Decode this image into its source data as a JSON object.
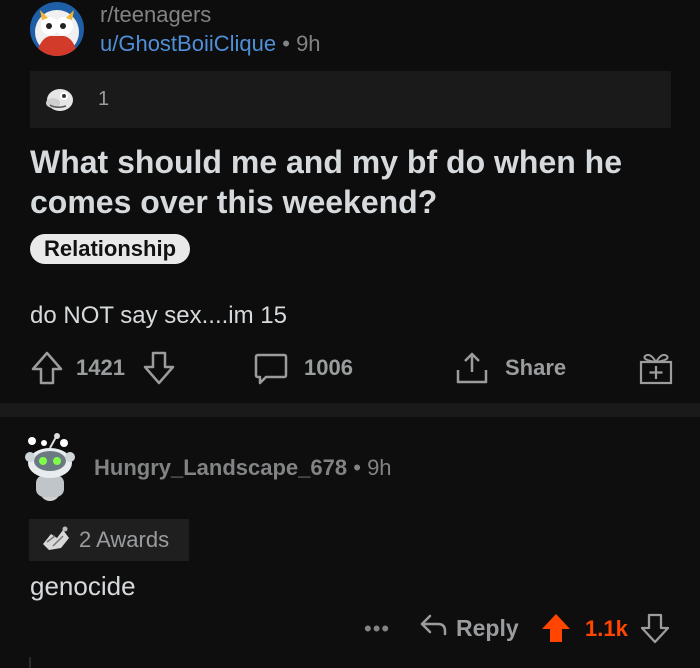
{
  "post": {
    "subreddit": "r/teenagers",
    "author": "u/GhostBoiiClique",
    "separator": "•",
    "age": "9h",
    "award_count": "1",
    "title": "What should me and my bf do when he comes over this weekend?",
    "flair": "Relationship",
    "body": "do NOT say sex....im 15",
    "upvotes": "1421",
    "comments": "1006",
    "share_label": "Share"
  },
  "comment": {
    "author": "Hungry_Landscape_678",
    "separator": "•",
    "age": "9h",
    "awards_label": "2 Awards",
    "text": "genocide",
    "more": "•••",
    "reply_label": "Reply",
    "score": "1.1k"
  },
  "colors": {
    "background": "#0b0b0b",
    "username_link": "#4f8fd8",
    "upvoted": "#ff4500",
    "muted_text": "#9a9c9e"
  },
  "icons": [
    "subreddit-avatar",
    "award-icon",
    "upvote-icon",
    "downvote-icon",
    "comment-icon",
    "share-icon",
    "gift-icon",
    "snoo-avatar",
    "wholesome-award-icon",
    "reply-icon"
  ]
}
